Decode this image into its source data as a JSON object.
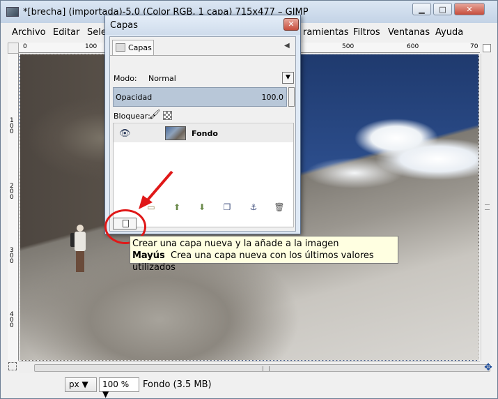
{
  "window": {
    "title": "*[brecha] (importada)-5.0 (Color RGB, 1 capa) 715x477 – GIMP",
    "minimize": "▁",
    "maximize": "□",
    "close": "✕"
  },
  "menu": {
    "archivo": "Archivo",
    "editar": "Editar",
    "seleccionar": "Sele",
    "herramientas": "ramientas",
    "filtros": "Filtros",
    "ventanas": "Ventanas",
    "ayuda": "Ayuda"
  },
  "ruler": {
    "top_ticks": [
      "0",
      "100",
      "500",
      "600",
      "70"
    ],
    "left_ticks": [
      "1\n0\n0",
      "2\n0\n0",
      "3\n0\n0",
      "4\n0\n0"
    ]
  },
  "statusbar": {
    "unit": "px",
    "zoom": "100 %",
    "info": "Fondo (3.5 MB)"
  },
  "layers_dialog": {
    "title": "Capas",
    "tab_label": "Capas",
    "mode_label": "Modo:",
    "mode_value": "Normal",
    "opacity_label": "Opacidad",
    "opacity_value": "100.0",
    "lock_label": "Bloquear:",
    "layers": [
      {
        "name": "Fondo",
        "visible": true
      }
    ]
  },
  "tooltip": {
    "line1": "Crear una capa nueva y la añade a la imagen",
    "modifier": "Mayús",
    "line2": "Crea una capa nueva con los últimos valores utilizados"
  },
  "icons": {
    "eye": "eye-icon",
    "new_layer": "new-layer-icon",
    "folder": "folder-icon",
    "raise": "raise-layer-icon",
    "lower": "lower-layer-icon",
    "duplicate": "duplicate-layer-icon",
    "anchor": "anchor-icon",
    "delete": "trash-icon"
  },
  "colors": {
    "annotation_red": "#e01818",
    "tooltip_bg": "#ffffe1"
  }
}
